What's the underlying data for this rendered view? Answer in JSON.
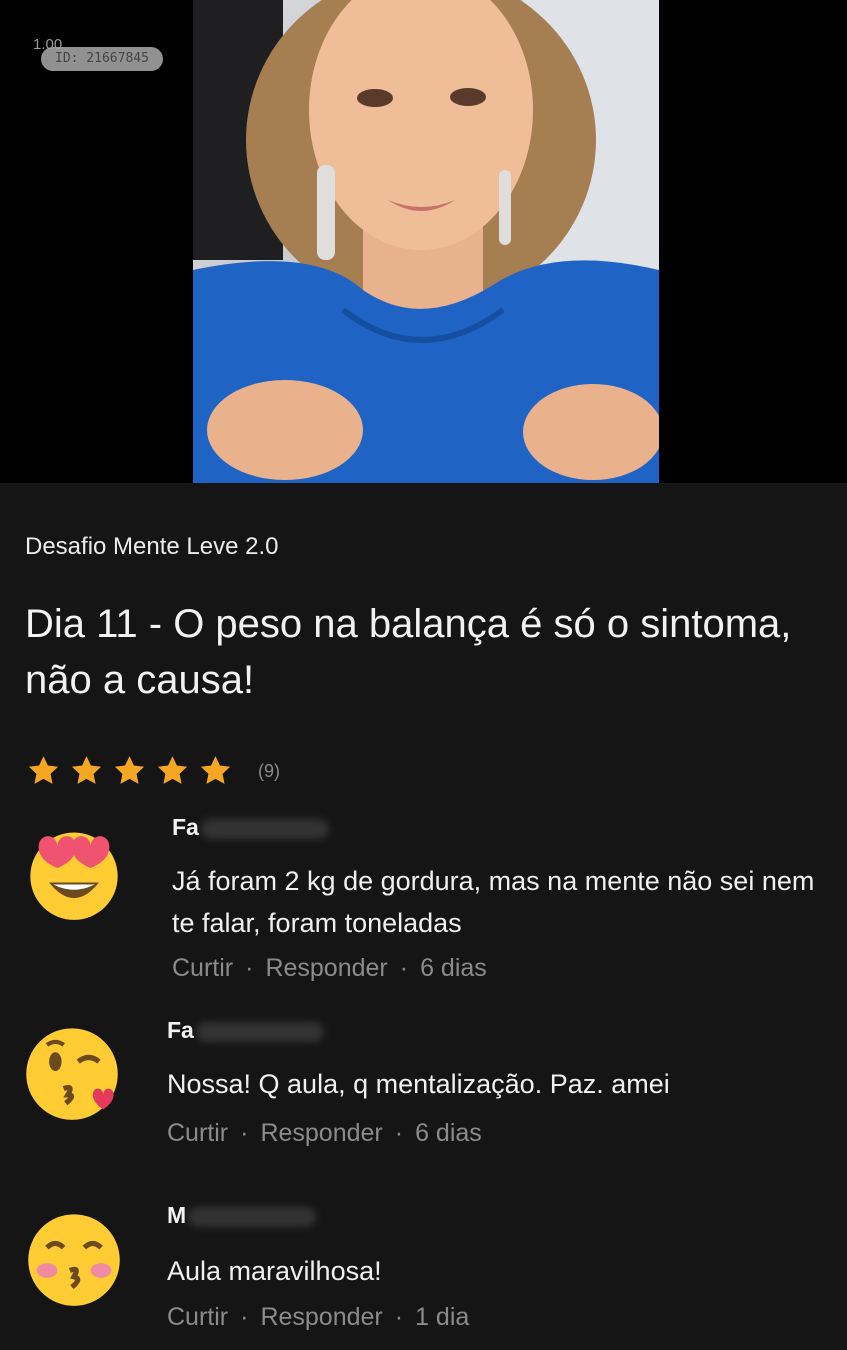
{
  "video": {
    "speed_label": "1.00",
    "id_label": "ID: 21667845"
  },
  "lesson": {
    "course_name": "Desafio Mente Leve 2.0",
    "title": "Dia 11 - O peso na balança é só o sintoma, não a causa!",
    "rating": {
      "stars": 5,
      "count_label": "(9)",
      "star_color": "#f5a623"
    }
  },
  "comments": [
    {
      "author": "Fa",
      "avatar_icon": "smiling-face-with-heart-eyes-icon",
      "text": "Já foram 2 kg de gordura, mas na mente não sei nem te falar, foram toneladas",
      "like_label": "Curtir",
      "reply_label": "Responder",
      "time": "6 dias"
    },
    {
      "author": "Fa",
      "avatar_icon": "face-blowing-a-kiss-icon",
      "text": "Nossa! Q aula, q mentalização. Paz. amei",
      "like_label": "Curtir",
      "reply_label": "Responder",
      "time": "6 dias"
    },
    {
      "author": "M",
      "avatar_icon": "kissing-face-with-smiling-eyes-icon",
      "text": "Aula maravilhosa!",
      "like_label": "Curtir",
      "reply_label": "Responder",
      "time": "1 dia"
    }
  ],
  "separator": "·"
}
